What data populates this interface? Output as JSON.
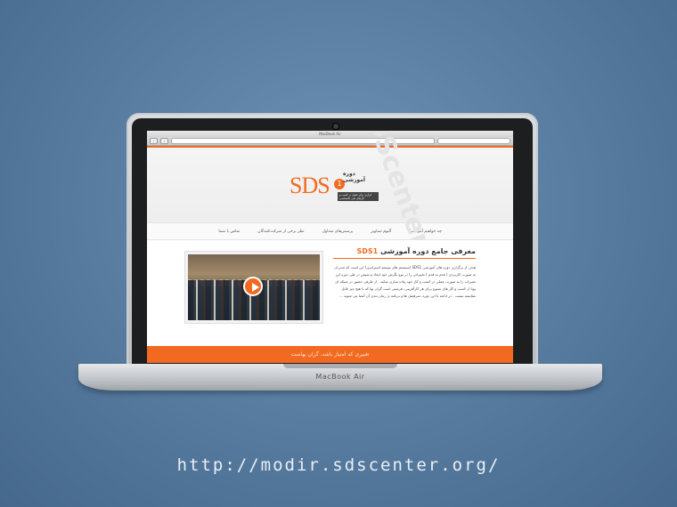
{
  "browser": {
    "window_title": "MacBook Air"
  },
  "site": {
    "logo_text": "SDS",
    "logo_number": "1",
    "logo_title": "دوره آموزشی",
    "logo_tagline": "ابزاری برای تحول در کسب و کارهای ملی اختصاصی"
  },
  "nav": {
    "items": [
      "چه خواهیم آموخت؟",
      "آلبوم تصاویر",
      "پرسش‌های متداول",
      "نظر برخی از شرکت‌کنندگان",
      "تماس با شما"
    ]
  },
  "article": {
    "title_prefix": "معرفی جامع دوره آموزشی",
    "title_highlight": "SDS1",
    "body": "هدف از برگزاری دوره های آموزشی SDS1 (سیستم های توسعه استراتژی) این است که مدیران به صورت کاربردی ( قدم به قدم ) تغییراتی را در نوع نگرش خود ایجاد و سپس در طی دوره این تغییرات را به صورت عملی در کسب و کار خود پیاده سازی نمایند . از طرفی حضور در شبکه ای پویا از کسب و کار های متنوع برای هر کارآفرینی، فرصتی است گران بها که با هیچ چیز قابل مقایسه نیست . در ادامه با این دوره، سرفصل ها و برنامه ی زمان بندی آن آشنا می شوید ..."
  },
  "footer": {
    "slogan": "تغییری که امتیاز باشد، گران بهاست"
  },
  "device": {
    "label": "MacBook Air"
  },
  "page_url": "http://modir.sdscenter.org/",
  "colors": {
    "accent": "#f26a21",
    "background": "#5a7fa3"
  }
}
